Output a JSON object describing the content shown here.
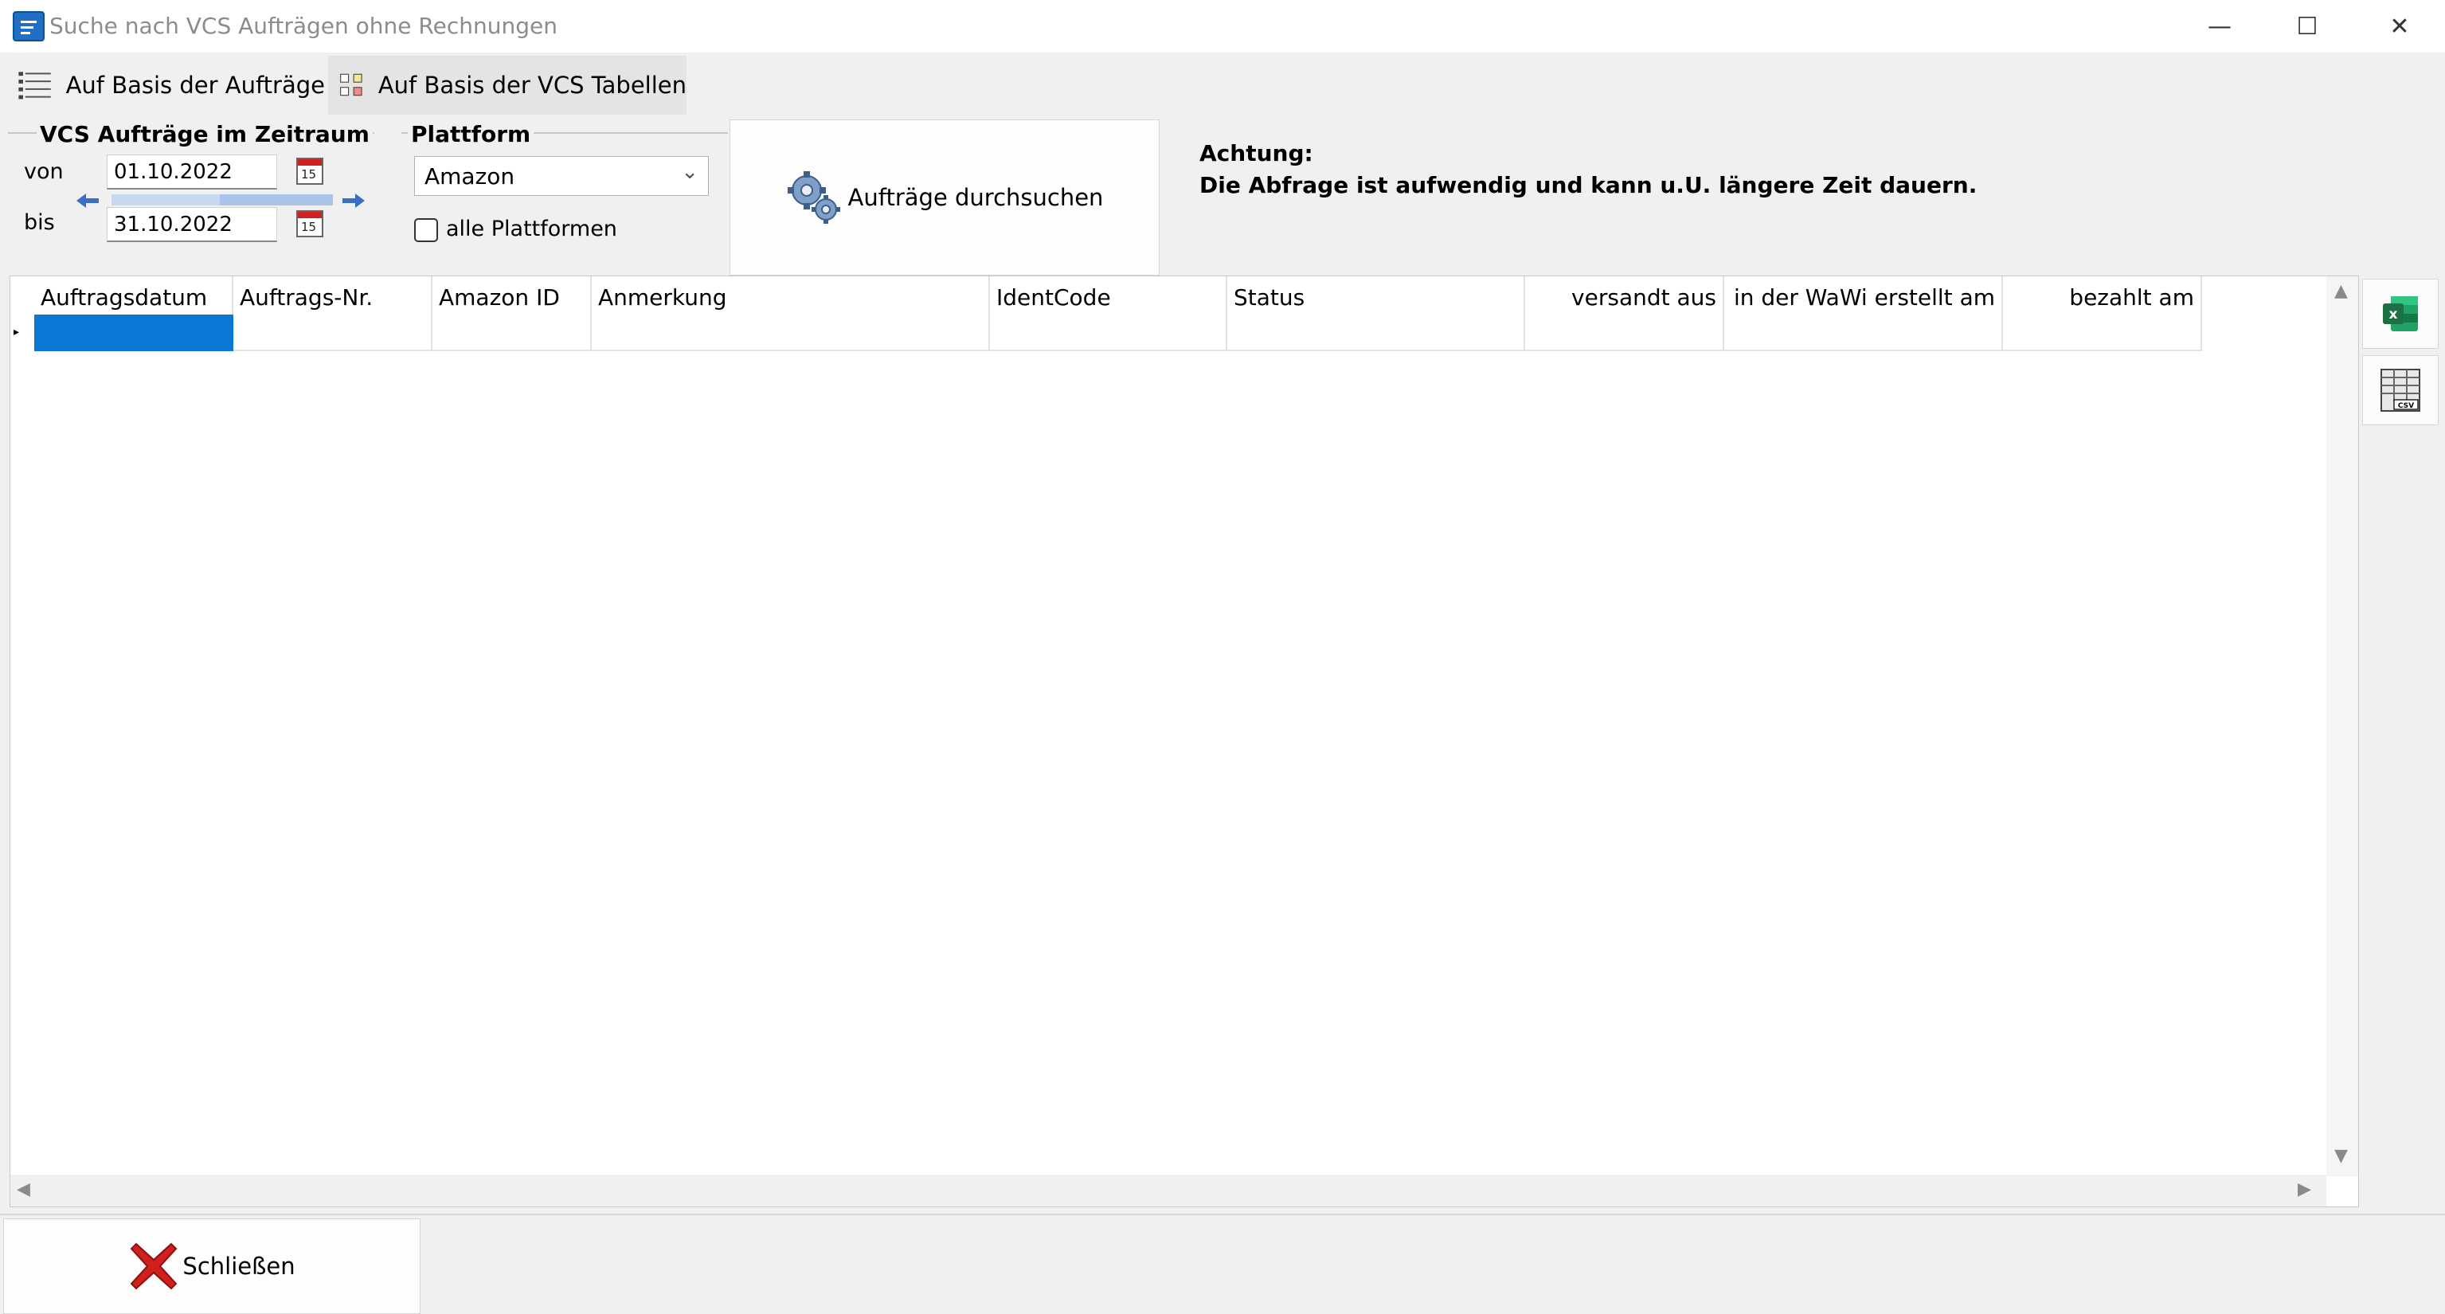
{
  "window": {
    "title": "Suche nach VCS Aufträgen ohne Rechnungen",
    "minimize": "—",
    "maximize": "☐",
    "close": "✕"
  },
  "tabs": [
    {
      "label": "Auf Basis der Aufträge",
      "icon": "list-icon",
      "active": true
    },
    {
      "label": "Auf Basis der VCS Tabellen",
      "icon": "table-grid-icon",
      "active": false
    }
  ],
  "period": {
    "title": "VCS Aufträge im Zeitraum",
    "from_label": "von",
    "from_value": "01.10.2022",
    "to_label": "bis",
    "to_value": "31.10.2022",
    "calendar_day": "15"
  },
  "platform": {
    "title": "Plattform",
    "selected": "Amazon",
    "all_label": "alle Plattformen",
    "all_checked": false
  },
  "search_button": {
    "label": "Aufträge durchsuchen",
    "icon": "gears-icon"
  },
  "warning": {
    "heading": "Achtung:",
    "text": "Die Abfrage ist aufwendig und kann u.U. längere Zeit dauern."
  },
  "grid": {
    "columns": [
      {
        "label": "Auftragsdatum"
      },
      {
        "label": "Auftrags-Nr."
      },
      {
        "label": "Amazon ID"
      },
      {
        "label": "Anmerkung"
      },
      {
        "label": "IdentCode"
      },
      {
        "label": "Status"
      },
      {
        "label": "versandt aus"
      },
      {
        "label": "in der WaWi erstellt am"
      },
      {
        "label": "bezahlt am"
      }
    ]
  },
  "side_buttons": [
    {
      "icon": "excel-icon"
    },
    {
      "icon": "csv-icon"
    }
  ],
  "footer": {
    "close_label": "Schließen",
    "close_icon": "close-red-x-icon"
  },
  "colors": {
    "accent": "#0a78d4",
    "background": "#f0f0f0",
    "close_red": "#d0201b",
    "excel_green": "#1d7044"
  }
}
